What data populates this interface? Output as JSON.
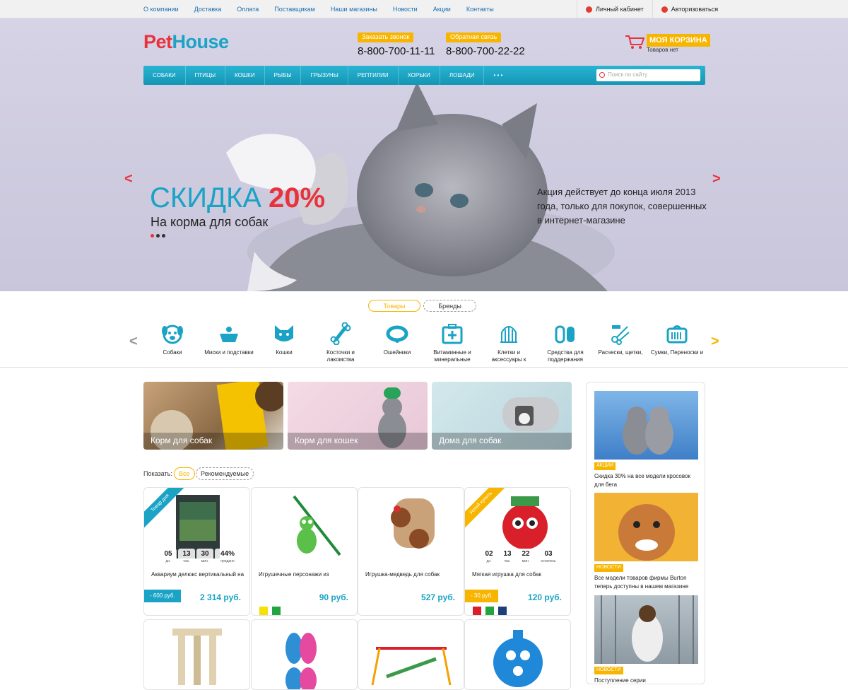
{
  "topnav": {
    "items": [
      "О компании",
      "Доставка",
      "Оплата",
      "Поставщикам",
      "Наши магазины",
      "Новости",
      "Акции",
      "Контакты"
    ],
    "cabinet": "Личный кабинет",
    "login": "Авторизоваться"
  },
  "logo": {
    "part1": "Pet",
    "part2": "House"
  },
  "header": {
    "callback_label": "Заказать звонок",
    "feedback_label": "Обратная связь",
    "phone1": "8-800-700-11-11",
    "phone2": "8-800-700-22-22",
    "cart_label": "МОЯ КОРЗИНА",
    "cart_sub": "Товаров нет"
  },
  "mainnav": {
    "items": [
      "СОБАКИ",
      "ПТИЦЫ",
      "КОШКИ",
      "РЫБЫ",
      "ГРЫЗУНЫ",
      "РЕПТИЛИИ",
      "ХОРЬКИ",
      "ЛОШАДИ",
      "• • •"
    ],
    "search_placeholder": "Поиск по сайту"
  },
  "hero": {
    "title": "СКИДКА",
    "percent": "20%",
    "subtitle": "На корма для собак",
    "text": "Акция действует до конца июля 2013 года, только для покупок, совершенных в интернет-магазине"
  },
  "tabs": {
    "goods": "Товары",
    "brands": "Бренды"
  },
  "categories": [
    "Собаки",
    "Миски и подставки",
    "Кошки",
    "Косточки и лакомства",
    "Ошейники",
    "Витаминные и минеральные",
    "Клетки и аксессуары к",
    "Средства для поддержания",
    "Расчески, щетки,",
    "Сумки, Переноски и"
  ],
  "banners": [
    "Корм для собак",
    "Корм для кошек",
    "Дома для собак"
  ],
  "filter": {
    "label": "Показать:",
    "all": "Все",
    "recommended": "Рекомендуемые"
  },
  "products": [
    {
      "name": "Аквариум делюкс вертикальный на",
      "price": "2 314 руб.",
      "discount": "- 600 руб.",
      "ribbon": "Товар дня",
      "timer": [
        {
          "v": "05",
          "u": "дн."
        },
        {
          "v": "13",
          "u": "час."
        },
        {
          "v": "30",
          "u": "мин."
        },
        {
          "v": "44%",
          "u": "продано"
        }
      ]
    },
    {
      "name": "Игрушечные персонажи из",
      "price": "90 руб."
    },
    {
      "name": "Игрушка-медведь для собак",
      "price": "527 руб."
    },
    {
      "name": "Мягкая игрушка для собак",
      "price": "120 руб.",
      "discount": "- 30 руб.",
      "ribbon": "Успей купить",
      "timer": [
        {
          "v": "02",
          "u": "дн."
        },
        {
          "v": "13",
          "u": "час."
        },
        {
          "v": "22",
          "u": "мин."
        },
        {
          "v": "03",
          "u": "осталось"
        }
      ]
    }
  ],
  "news": [
    {
      "tag": "АКЦИИ",
      "text": "Скидка 30% на все модели кросовок для бега"
    },
    {
      "tag": "НОВОСТИ",
      "text": "Все модели товаров фирмы Burton теперь доступны в нашем магазине"
    },
    {
      "tag": "НОВОСТИ",
      "text": "Поступление серии"
    }
  ],
  "colors": {
    "accent": "#1aa3c5",
    "red": "#e8323c",
    "yellow": "#f7b500"
  }
}
